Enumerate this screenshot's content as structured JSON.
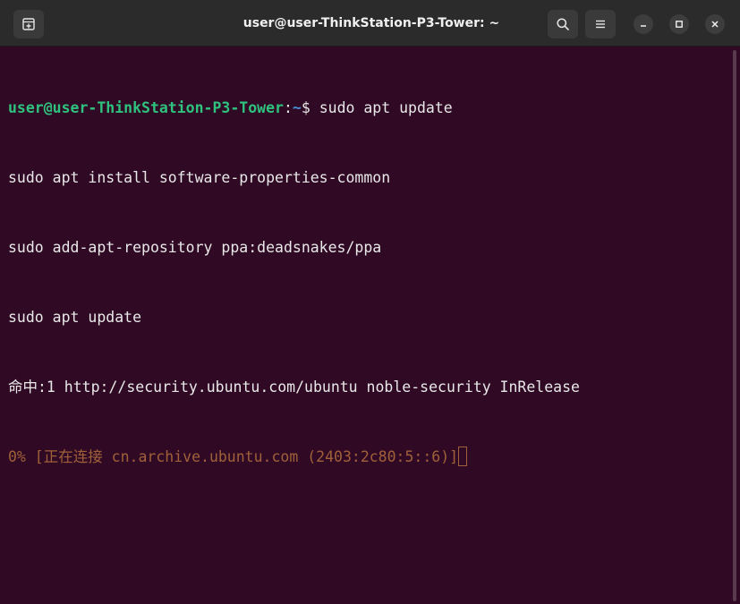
{
  "window": {
    "title": "user@user-ThinkStation-P3-Tower: ~"
  },
  "icons": {
    "new_tab": "new-tab-icon",
    "search": "search-icon",
    "menu": "hamburger-menu-icon",
    "minimize": "minimize-icon",
    "maximize": "maximize-icon",
    "close": "close-icon"
  },
  "colors": {
    "terminal_bg": "#300a24",
    "prompt_user": "#2ec27e",
    "prompt_path": "#4a8fd9",
    "progress_text": "#a0603a"
  },
  "terminal": {
    "prompt_user": "user@user-ThinkStation-P3-Tower",
    "prompt_sep": ":",
    "prompt_path": "~",
    "prompt_symbol": "$ ",
    "command": "sudo apt update",
    "lines": [
      "sudo apt install software-properties-common",
      "sudo add-apt-repository ppa:deadsnakes/ppa",
      "sudo apt update",
      "命中:1 http://security.ubuntu.com/ubuntu noble-security InRelease"
    ],
    "progress_line": "0% [正在连接 cn.archive.ubuntu.com (2403:2c80:5::6)]"
  }
}
